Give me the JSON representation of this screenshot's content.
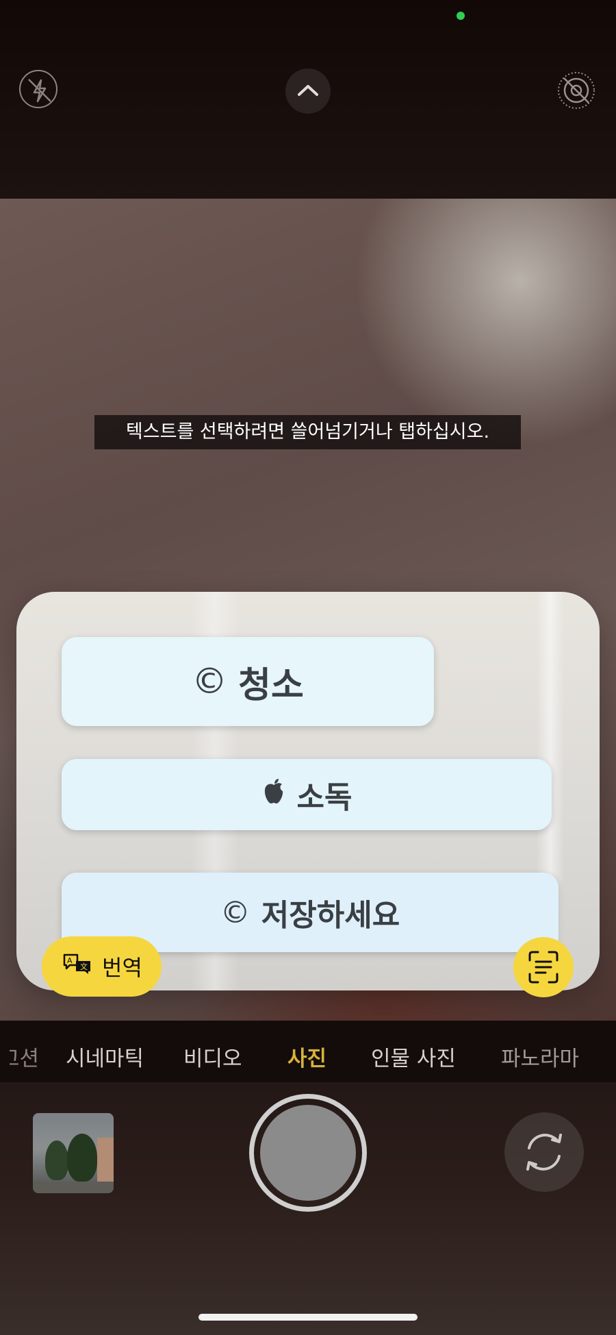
{
  "status": {
    "indicator_color": "#2ecf52"
  },
  "top_controls": {
    "flash_icon": "flash-off-icon",
    "chevron_icon": "chevron-up-icon",
    "live_icon": "live-photo-off-icon"
  },
  "viewfinder": {
    "guide_text": "텍스트를 선택하려면 쓸어넘기거나 탭하십시오.",
    "detected_text": [
      {
        "glyph": "©",
        "label": "청소"
      },
      {
        "glyph": "",
        "label": "소독"
      },
      {
        "glyph": "©",
        "label": "저장하세요"
      }
    ]
  },
  "actions": {
    "translate_label": "번역",
    "translate_icon": "translate-icon",
    "scan_icon": "text-scan-icon",
    "accent_color": "#f6d63e"
  },
  "modes": {
    "items": [
      "고션",
      "시네마틱",
      "비디오",
      "사진",
      "인물 사진",
      "파노라마"
    ],
    "selected": "사진",
    "selected_color": "#d7b23c"
  },
  "bottom_controls": {
    "thumbnail_icon": "last-photo-thumbnail",
    "shutter_icon": "shutter-button",
    "flip_icon": "camera-flip-icon"
  }
}
